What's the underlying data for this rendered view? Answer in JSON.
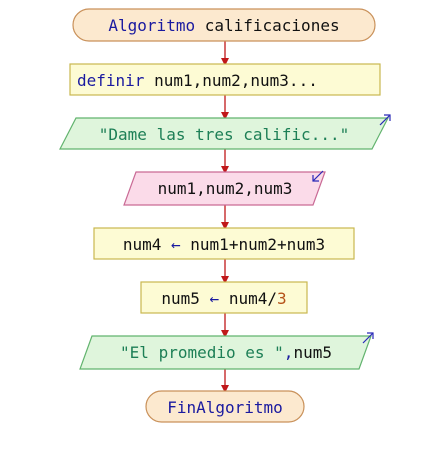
{
  "diagram": {
    "start": {
      "keyword": "Algoritmo",
      "name": " calificaciones"
    },
    "define": {
      "keyword": "definir",
      "vars": " num1,num2,num3..."
    },
    "output1": {
      "text": "\"Dame las tres calific...\""
    },
    "input": {
      "vars": "num1,num2,num3"
    },
    "assign1": {
      "target": "num4",
      "arrow": " ← ",
      "expr": "num1+num2+num3"
    },
    "assign2": {
      "target": "num5",
      "arrow": " ← ",
      "expr": "num4/",
      "literal": "3"
    },
    "output2": {
      "text": "\"El promedio es \"",
      "sep": ",",
      "var": "num5"
    },
    "end": {
      "keyword": "FinAlgoritmo"
    }
  },
  "colors": {
    "terminal_fill": "#fce9cf",
    "terminal_stroke": "#c9915a",
    "process_fill": "#fdfbd4",
    "process_stroke": "#c9b84f",
    "output_fill": "#dff5dc",
    "output_stroke": "#62b36e",
    "input_fill": "#fbdbe9",
    "input_stroke": "#c96a95",
    "arrow": "#c0181a",
    "io_arrow": "#2a2ab8"
  }
}
